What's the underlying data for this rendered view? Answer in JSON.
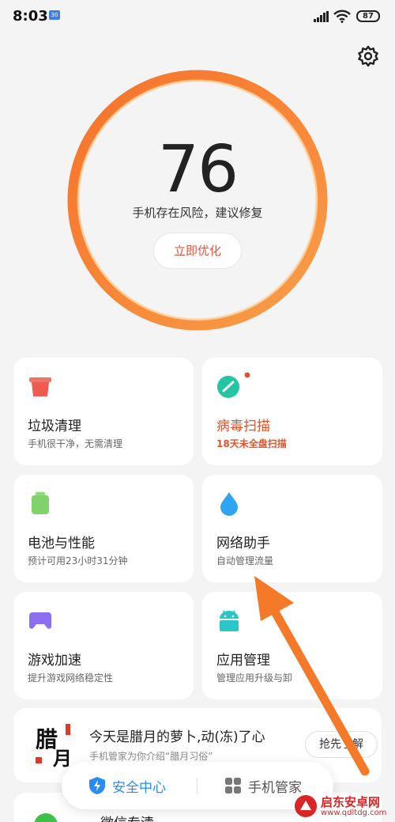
{
  "status_bar": {
    "time": "8:03",
    "notification_badge": "30",
    "battery": "87"
  },
  "score": {
    "value": "76",
    "description": "手机存在风险，建议修复",
    "action_label": "立即优化",
    "ring_colors": [
      "#f4722b",
      "#ffb15a"
    ]
  },
  "cards": [
    {
      "title": "垃圾清理",
      "subtitle": "手机很干净，无需清理",
      "icon": "trash-bin-icon",
      "color": "#ef5b4f",
      "warning": false
    },
    {
      "title": "病毒扫描",
      "subtitle": "18天未全盘扫描",
      "icon": "scan-icon",
      "color": "#23c6a0",
      "warning": true
    },
    {
      "title": "电池与性能",
      "subtitle": "预计可用23小时31分钟",
      "icon": "battery-icon",
      "color": "#7fd36a",
      "warning": false
    },
    {
      "title": "网络助手",
      "subtitle": "自动管理流量",
      "icon": "water-drop-icon",
      "color": "#2ea5f0",
      "warning": false
    },
    {
      "title": "游戏加速",
      "subtitle": "提升游戏网络稳定性",
      "icon": "gamepad-icon",
      "color": "#8c6ef0",
      "warning": false
    },
    {
      "title": "应用管理",
      "subtitle": "管理应用升级与卸",
      "icon": "android-icon",
      "color": "#29c7c7",
      "warning": false
    }
  ],
  "news": {
    "thumb_text_top": "腊",
    "thumb_text_bottom": "月",
    "headline": "今天是腊月的萝卜,动(冻)了心",
    "subtitle": "手机管家为你介绍“腊月习俗”",
    "action_label": "抢先了解"
  },
  "next_card": {
    "title": "微信专清"
  },
  "bottom_nav": {
    "tab_security": "安全中心",
    "tab_manager": "手机管家",
    "active_color": "#2a8bf2"
  },
  "watermark": {
    "name": "启东安卓网",
    "url": "www.qdltdg.com"
  }
}
